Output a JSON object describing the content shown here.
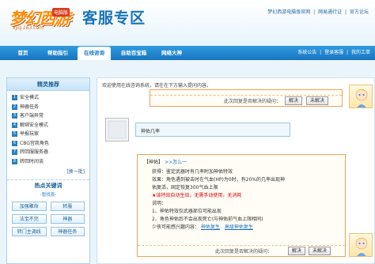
{
  "header": {
    "logo_title": "梦幻西游",
    "logo_mark": "电脑版",
    "logo_sub": "xyq.163.com",
    "page_title": "客服专区",
    "toplinks": [
      "梦幻西游电脑版官网",
      "|",
      "网易通行证",
      "|",
      "官方论坛"
    ]
  },
  "nav": {
    "items": [
      "首页",
      "帮助指引",
      "在线咨询",
      "自助百宝箱",
      "网络大神"
    ],
    "active_index": 2,
    "right_links": [
      "系统公告",
      "|",
      "登录客服",
      "|",
      "我的工单"
    ]
  },
  "sidebar": {
    "title": "精灵推荐",
    "items": [
      {
        "num": "1",
        "label": "安全模式"
      },
      {
        "num": "2",
        "label": "神器任务"
      },
      {
        "num": "3",
        "label": "客户端异常"
      },
      {
        "num": "4",
        "label": "解绑安全模式"
      },
      {
        "num": "5",
        "label": "举报玩家"
      },
      {
        "num": "6",
        "label": "CBG宫商角色"
      },
      {
        "num": "7",
        "label": "转回服服务器"
      },
      {
        "num": "8",
        "label": "转回时间谈"
      }
    ],
    "switch_label": "[换一批]",
    "hot_title": "热点关键词",
    "hot_sub": "-暂找夜-",
    "keywords": [
      "加强聚命",
      "转服",
      "法宝不完",
      "神器",
      "转门主调线",
      "神器任务"
    ]
  },
  "chat": {
    "welcome": "欢迎使用在线咨询系统，请在在下方输入提问内容。",
    "question_prompt": "此次回复是否解决的疑问：",
    "solved_label": "解决",
    "unsolved_label": "未解决",
    "user_message": "神佑几率",
    "answer": {
      "tag": "【神佑】",
      "link": ">>怎么一",
      "lines": [
        "获得：鉴定武器时有几率附加神佑特效",
        "效果：角色遇到被击时在气血(HP)为0时，有20%的几率出现神",
        "佑复活，固定恢复300气血上限",
        "★该特效自动生效，无需手动使用，无消耗",
        "说明：",
        "1、神佑特效仅武器部位可能出现",
        "2、角色神佑后不会出现死亡(与神佑前气血上限相同)",
        "少侠可能感兴趣内容："
      ],
      "related": [
        "神佑复生",
        "高级神佑复生"
      ]
    }
  }
}
